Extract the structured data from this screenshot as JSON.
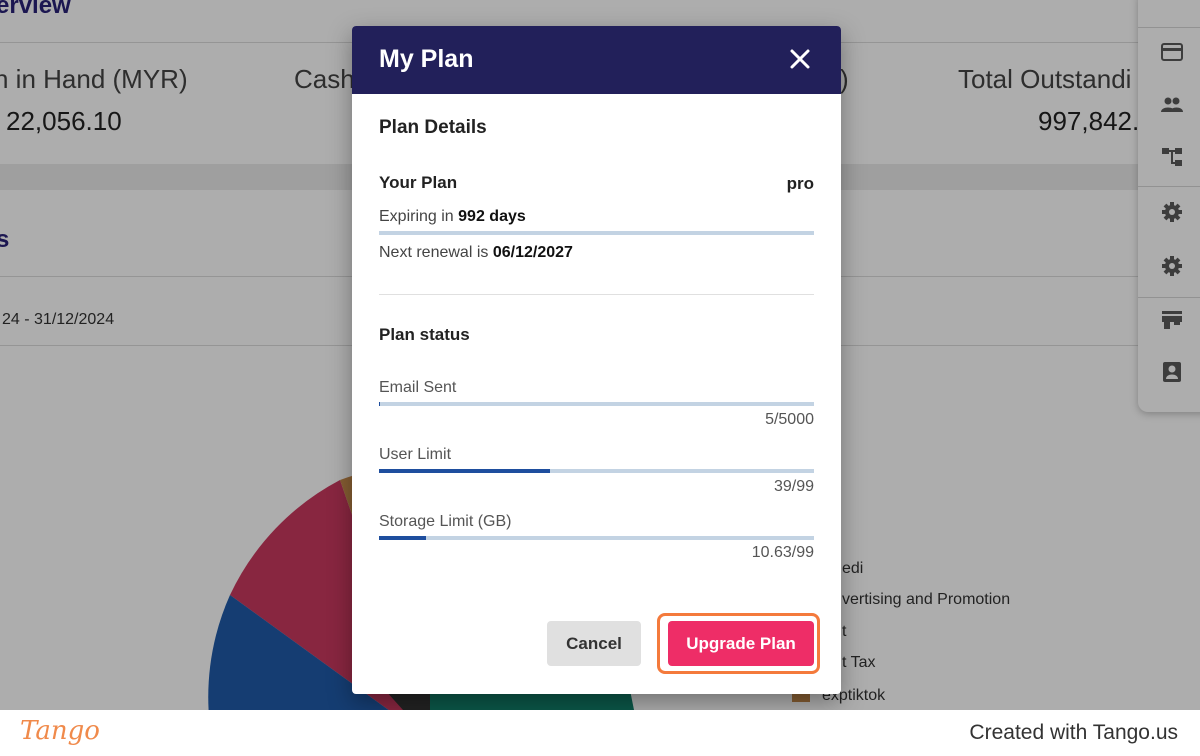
{
  "background": {
    "overview_title": "erview",
    "stats": [
      {
        "label": "n in Hand (MYR)",
        "value": "22,056.10"
      },
      {
        "label": "Cash",
        "value": ""
      },
      {
        "label": ")",
        "value": ""
      },
      {
        "label": "Total Outstandi",
        "value": "997,842."
      }
    ],
    "section_title": "s",
    "date_range": "24 - 31/12/2024",
    "legend": [
      {
        "label": "edi",
        "color": ""
      },
      {
        "label": "vertising and Promotion",
        "color": ""
      },
      {
        "label": "t",
        "color": ""
      },
      {
        "label": "t Tax",
        "color": ""
      },
      {
        "label": "exptiktok",
        "color": "#c58a4a"
      }
    ],
    "pie_colors": [
      "#c9385f",
      "#1f5aa8",
      "#11806b",
      "#c58a4a",
      "#333333"
    ],
    "sidebar_icons": [
      "credit-card-icon",
      "people-icon",
      "hierarchy-icon",
      "settings-icon",
      "settings-icon",
      "store-icon",
      "contact-icon"
    ]
  },
  "dialog": {
    "title": "My Plan",
    "close_icon": "close-icon",
    "plan_details_heading": "Plan Details",
    "your_plan_label": "Your Plan",
    "your_plan_value": "pro",
    "expiring_prefix": "Expiring in",
    "expiring_value": "992 days",
    "renewal_prefix": "Next renewal is",
    "renewal_value": "06/12/2027",
    "plan_status_heading": "Plan status",
    "metrics": [
      {
        "label": "Email Sent",
        "count": "5/5000",
        "fraction": 0.001
      },
      {
        "label": "User Limit",
        "count": "39/99",
        "fraction": 0.394
      },
      {
        "label": "Storage Limit (GB)",
        "count": "10.63/99",
        "fraction": 0.107
      }
    ],
    "cancel_label": "Cancel",
    "upgrade_label": "Upgrade Plan"
  },
  "footer": {
    "logo": "Tango",
    "credit": "Created with Tango.us"
  },
  "colors": {
    "dialog_header": "#22205a",
    "upgrade_button": "#ee2d67",
    "highlight_ring": "#f47a3c",
    "progress_fill": "#1e4e9e",
    "progress_track": "#c3d3e3"
  }
}
